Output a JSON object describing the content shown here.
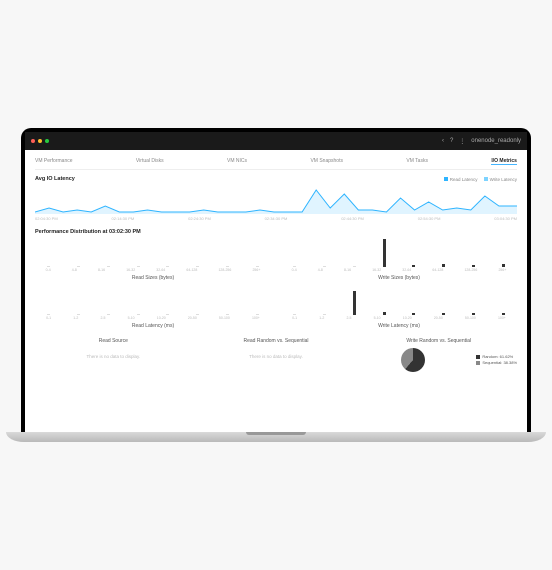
{
  "titlebar": {
    "back_icon": "‹",
    "help_icon": "?",
    "menu_icon": "⋮",
    "username": "onenode_readonly"
  },
  "tabs": [
    {
      "label": "VM Performance"
    },
    {
      "label": "Virtual Disks"
    },
    {
      "label": "VM NICs"
    },
    {
      "label": "VM Snapshots"
    },
    {
      "label": "VM Tasks"
    },
    {
      "label": "I/O Metrics",
      "active": true
    }
  ],
  "latency": {
    "title": "Avg IO Latency",
    "legend_read": "Read Latency",
    "legend_write": "Write Latency"
  },
  "dist_title": "Performance Distribution at 03:02:30 PM",
  "panels": {
    "read_sizes": "Read Sizes (bytes)",
    "write_sizes": "Write Sizes (bytes)",
    "read_latency": "Read Latency (ms)",
    "write_latency": "Write Latency (ms)",
    "read_source": "Read Source",
    "read_rs": "Read Random vs. Sequential",
    "write_rs": "Write Random vs. Sequential"
  },
  "no_data": "There is no data to display.",
  "pie_legend": {
    "random": "Random: 61.62%",
    "sequential": "Sequential: 38.38%"
  },
  "chart_data": {
    "latency_line": {
      "type": "line",
      "title": "Avg IO Latency",
      "series": [
        {
          "name": "Read Latency",
          "values": [
            1,
            3,
            1,
            2,
            1,
            4,
            1,
            1,
            2,
            1,
            1,
            1,
            2,
            1,
            1,
            1,
            2,
            1,
            1,
            1,
            12,
            3,
            10,
            2,
            2,
            1,
            8,
            2,
            6,
            2,
            3,
            2,
            9,
            4
          ]
        },
        {
          "name": "Write Latency",
          "values": [
            0,
            0,
            0,
            0,
            0,
            0,
            0,
            0,
            0,
            0,
            0,
            0,
            0,
            0,
            0,
            0,
            0,
            0,
            0,
            0,
            0,
            0,
            0,
            0,
            0,
            0,
            0,
            0,
            0,
            0,
            0,
            0,
            0,
            0
          ]
        }
      ],
      "x_ticks": [
        "02:04:30 PM",
        "02:14:30 PM",
        "02:24:30 PM",
        "02:34:30 PM",
        "02:44:30 PM",
        "02:54:30 PM",
        "03:04:30 PM"
      ],
      "ylim": [
        0,
        14
      ]
    },
    "read_sizes": {
      "type": "bar",
      "categories": [
        "0-4",
        "4-8",
        "8-16",
        "16-32",
        "32-64",
        "64-128",
        "128-256",
        "256+"
      ],
      "values": [
        0,
        0,
        0,
        0,
        0,
        0,
        0,
        0
      ],
      "title": "Read Sizes (bytes)"
    },
    "write_sizes": {
      "type": "bar",
      "categories": [
        "0-4",
        "4-8",
        "8-16",
        "16-32",
        "32-64",
        "64-128",
        "128-256",
        "256+"
      ],
      "values": [
        0,
        0,
        0,
        28,
        2,
        3,
        2,
        3
      ],
      "title": "Write Sizes (bytes)",
      "ylim": [
        0,
        30
      ]
    },
    "read_latency": {
      "type": "bar",
      "categories": [
        "0-1",
        "1-2",
        "2-5",
        "5-10",
        "10-20",
        "20-50",
        "50-100",
        "100+"
      ],
      "values": [
        0,
        0,
        0,
        0,
        0,
        0,
        0,
        0
      ],
      "title": "Read Latency (ms)"
    },
    "write_latency": {
      "type": "bar",
      "categories": [
        "0-1",
        "1-2",
        "2-5",
        "5-10",
        "10-20",
        "20-50",
        "50-100",
        "100+"
      ],
      "values": [
        0,
        0,
        24,
        3,
        2,
        2,
        2,
        2
      ],
      "title": "Write Latency (ms)",
      "ylim": [
        0,
        26
      ]
    },
    "write_rs_pie": {
      "type": "pie",
      "title": "Write Random vs. Sequential",
      "series": [
        {
          "name": "Random",
          "value": 61.62
        },
        {
          "name": "Sequential",
          "value": 38.38
        }
      ]
    }
  }
}
